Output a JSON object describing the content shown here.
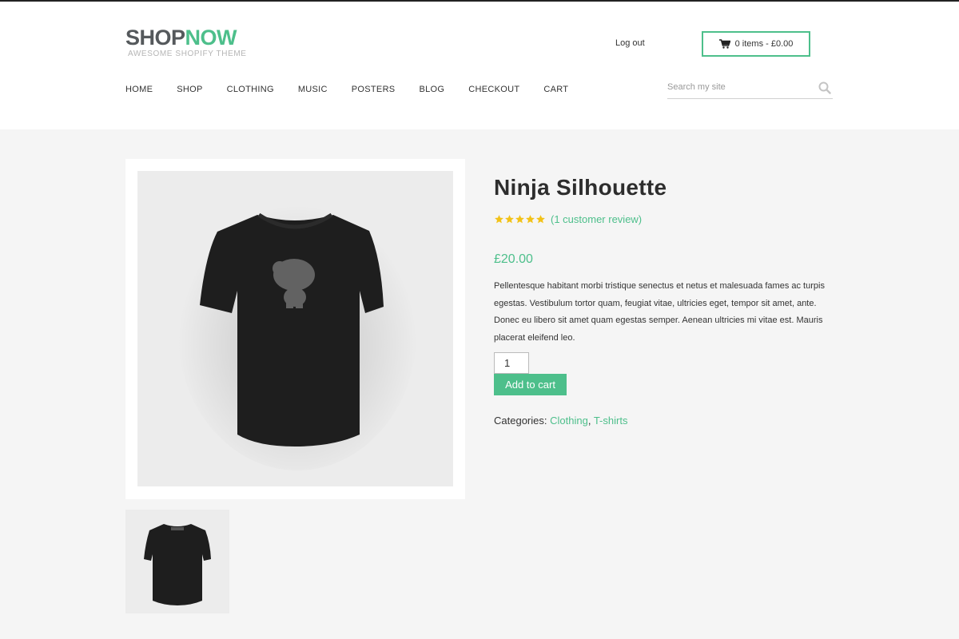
{
  "brand": {
    "name_part1": "SHOP",
    "name_part2": "NOW",
    "tagline": "AWESOME SHOPIFY THEME",
    "accent_color": "#4dbf8b"
  },
  "header": {
    "logout_label": "Log out",
    "cart_label": "0 items - £0.00",
    "cart_icon": "shopping-cart-icon",
    "search_placeholder": "Search my site",
    "search_value": "",
    "search_icon": "search-icon"
  },
  "nav": {
    "items": [
      {
        "label": "HOME"
      },
      {
        "label": "SHOP"
      },
      {
        "label": "CLOTHING"
      },
      {
        "label": "MUSIC"
      },
      {
        "label": "POSTERS"
      },
      {
        "label": "BLOG"
      },
      {
        "label": "CHECKOUT"
      },
      {
        "label": "CART"
      }
    ]
  },
  "product": {
    "title": "Ninja Silhouette",
    "rating": 5,
    "rating_max": 5,
    "star_color": "#f2c218",
    "review_link": "(1 customer review)",
    "price": "£20.00",
    "description": "Pellentesque habitant morbi tristique senectus et netus et malesuada fames ac turpis egestas. Vestibulum tortor quam, feugiat vitae, ultricies eget, tempor sit amet, ante. Donec eu libero sit amet quam egestas semper. Aenean ultricies mi vitae est. Mauris placerat eleifend leo.",
    "quantity": "1",
    "add_to_cart_label": "Add to cart",
    "categories_label": "Categories:",
    "categories": [
      {
        "label": "Clothing"
      },
      {
        "label": "T-shirts"
      }
    ],
    "category_separator": ",",
    "main_image": "black-tshirt-front-image",
    "thumbnail_image": "black-tshirt-back-image"
  }
}
